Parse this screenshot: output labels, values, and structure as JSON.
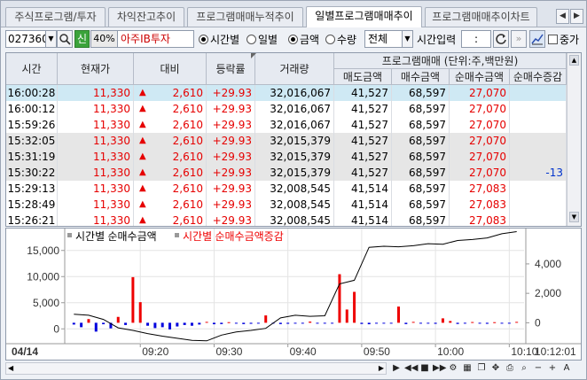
{
  "tabs": [
    {
      "label": "주식프로그램/투자",
      "active": false
    },
    {
      "label": "차익잔고추이",
      "active": false
    },
    {
      "label": "프로그램매매누적추이",
      "active": false
    },
    {
      "label": "일별프로그램매매추이",
      "active": true
    },
    {
      "label": "프로그램매매추이차트",
      "active": false
    }
  ],
  "toolbar": {
    "stock_code": "027360",
    "market_badge": "신",
    "margin_rate": "40%",
    "stock_name": "아주IB투자",
    "radio_time": "시간별",
    "radio_daily": "일별",
    "radio_amount": "금액",
    "radio_quantity": "수량",
    "filter_value": "전체",
    "time_input_label": "시간입력",
    "time_input_value": " : ",
    "overlap_label": "중가"
  },
  "table": {
    "headers": {
      "time": "시간",
      "price": "현재가",
      "change": "대비",
      "rate": "등락률",
      "volume": "거래량",
      "group": "프로그램매매  (단위:주,백만원)",
      "sell": "매도금액",
      "buy": "매수금액",
      "net": "순매수금액",
      "net_change": "순매수증감"
    },
    "rows": [
      {
        "time": "16:00:28",
        "price": "11,330",
        "arrow": "▲",
        "change": "2,610",
        "rate": "+29.93",
        "volume": "32,016,067",
        "sell": "41,527",
        "buy": "68,597",
        "net": "27,070",
        "net_change": ""
      },
      {
        "time": "16:00:12",
        "price": "11,330",
        "arrow": "▲",
        "change": "2,610",
        "rate": "+29.93",
        "volume": "32,016,067",
        "sell": "41,527",
        "buy": "68,597",
        "net": "27,070",
        "net_change": ""
      },
      {
        "time": "15:59:26",
        "price": "11,330",
        "arrow": "▲",
        "change": "2,610",
        "rate": "+29.93",
        "volume": "32,016,067",
        "sell": "41,527",
        "buy": "68,597",
        "net": "27,070",
        "net_change": ""
      },
      {
        "time": "15:32:05",
        "price": "11,330",
        "arrow": "▲",
        "change": "2,610",
        "rate": "+29.93",
        "volume": "32,015,379",
        "sell": "41,527",
        "buy": "68,597",
        "net": "27,070",
        "net_change": ""
      },
      {
        "time": "15:31:19",
        "price": "11,330",
        "arrow": "▲",
        "change": "2,610",
        "rate": "+29.93",
        "volume": "32,015,379",
        "sell": "41,527",
        "buy": "68,597",
        "net": "27,070",
        "net_change": ""
      },
      {
        "time": "15:30:22",
        "price": "11,330",
        "arrow": "▲",
        "change": "2,610",
        "rate": "+29.93",
        "volume": "32,015,379",
        "sell": "41,527",
        "buy": "68,597",
        "net": "27,070",
        "net_change": "-13"
      },
      {
        "time": "15:29:13",
        "price": "11,330",
        "arrow": "▲",
        "change": "2,610",
        "rate": "+29.93",
        "volume": "32,008,545",
        "sell": "41,514",
        "buy": "68,597",
        "net": "27,083",
        "net_change": ""
      },
      {
        "time": "15:28:49",
        "price": "11,330",
        "arrow": "▲",
        "change": "2,610",
        "rate": "+29.93",
        "volume": "32,008,545",
        "sell": "41,514",
        "buy": "68,597",
        "net": "27,083",
        "net_change": ""
      },
      {
        "time": "15:26:21",
        "price": "11,330",
        "arrow": "▲",
        "change": "2,610",
        "rate": "+29.93",
        "volume": "32,008,545",
        "sell": "41,514",
        "buy": "68,597",
        "net": "27,083",
        "net_change": ""
      }
    ]
  },
  "chart": {
    "legend_line": "시간별 순매수금액",
    "legend_bar": "시간별 순매수금액증감",
    "date_label": "04/14",
    "cursor_time": "10:12:01",
    "left_ticks": [
      "15,000",
      "10,000",
      "5,000",
      "0"
    ],
    "right_ticks": [
      "4,000",
      "2,000",
      "0"
    ],
    "x_ticks": [
      "09:20",
      "09:30",
      "09:40",
      "09:50",
      "10:00",
      "10:10"
    ],
    "colors": {
      "up": "#ee0000",
      "down": "#0000dd",
      "line": "#000000"
    }
  },
  "chart_data": {
    "type": "bar",
    "title": "",
    "series": [
      {
        "name": "시간별 순매수금액",
        "kind": "line",
        "axis": "left",
        "x": [
          "09:11",
          "09:13",
          "09:15",
          "09:17",
          "09:19",
          "09:21",
          "09:23",
          "09:25",
          "09:27",
          "09:29",
          "09:31",
          "09:33",
          "09:35",
          "09:37",
          "09:39",
          "09:41",
          "09:43",
          "09:45",
          "09:47",
          "09:49",
          "09:51",
          "09:53",
          "09:55",
          "09:57",
          "09:59",
          "10:01",
          "10:03",
          "10:05",
          "10:07",
          "10:09",
          "10:11"
        ],
        "values": [
          2800,
          2600,
          1800,
          200,
          -300,
          -900,
          -1400,
          -1800,
          -2200,
          -2300,
          -1200,
          -600,
          -300,
          100,
          2100,
          2600,
          2400,
          2500,
          8600,
          9300,
          15600,
          15800,
          15700,
          15900,
          16300,
          16200,
          16900,
          17100,
          17400,
          18200,
          18600
        ]
      },
      {
        "name": "시간별 순매수금액증감",
        "kind": "bar",
        "axis": "right",
        "x": [
          "09:11",
          "09:12",
          "09:13",
          "09:14",
          "09:15",
          "09:16",
          "09:17",
          "09:18",
          "09:19",
          "09:20",
          "09:21",
          "09:22",
          "09:23",
          "09:24",
          "09:25",
          "09:26",
          "09:27",
          "09:28",
          "09:29",
          "09:30",
          "09:31",
          "09:32",
          "09:33",
          "09:34",
          "09:35",
          "09:36",
          "09:37",
          "09:38",
          "09:39",
          "09:40",
          "09:41",
          "09:42",
          "09:43",
          "09:44",
          "09:45",
          "09:46",
          "09:47",
          "09:48",
          "09:49",
          "09:50",
          "09:51",
          "09:52",
          "09:53",
          "09:54",
          "09:55",
          "09:56",
          "09:57",
          "09:58",
          "09:59",
          "10:00",
          "10:01",
          "10:02",
          "10:03",
          "10:04",
          "10:05",
          "10:06",
          "10:07",
          "10:08",
          "10:09",
          "10:10",
          "10:11"
        ],
        "values": [
          -120,
          -300,
          250,
          -600,
          -100,
          -380,
          400,
          -150,
          3100,
          1400,
          -200,
          -360,
          -300,
          -450,
          -250,
          -150,
          -200,
          -120,
          60,
          -100,
          -90,
          40,
          -60,
          -90,
          -70,
          -60,
          500,
          -40,
          -90,
          -70,
          -50,
          -60,
          80,
          -50,
          -40,
          -60,
          3300,
          900,
          2100,
          -80,
          -100,
          -40,
          -60,
          -50,
          1100,
          -90,
          60,
          -60,
          -40,
          -70,
          300,
          120,
          -80,
          -60,
          50,
          -40,
          -70,
          40,
          -50,
          -30,
          60
        ]
      }
    ],
    "ylim_left": [
      -2500,
      17500
    ],
    "ylim_right": [
      -1300,
      5800
    ],
    "xlabel": "",
    "ylabel": ""
  }
}
